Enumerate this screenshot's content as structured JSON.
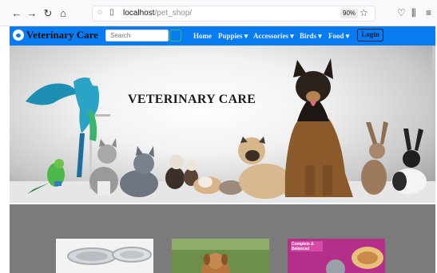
{
  "browser": {
    "url_host": "localhost",
    "url_path": "/pet_shop/",
    "zoom": "90%"
  },
  "navbar": {
    "brand": "Veterinary Care",
    "search_placeholder": "Search",
    "menu": [
      {
        "label": "Home"
      },
      {
        "label": "Puppies ▾"
      },
      {
        "label": "Accessories ▾"
      },
      {
        "label": "Birds ▾"
      },
      {
        "label": "Food ▾"
      }
    ],
    "login": "Login"
  },
  "hero": {
    "title": "VETERINARY CARE"
  },
  "cards": [
    {
      "caption": ""
    },
    {
      "caption": ""
    },
    {
      "caption": "Complete & Balanced"
    }
  ],
  "colors": {
    "navbar": "#0a7cf2",
    "band": "#7b7b7b"
  }
}
